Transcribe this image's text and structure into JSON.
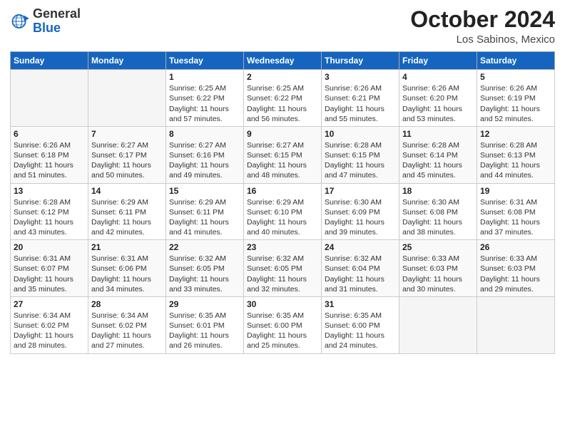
{
  "header": {
    "logo_general": "General",
    "logo_blue": "Blue",
    "month_title": "October 2024",
    "location": "Los Sabinos, Mexico"
  },
  "days_of_week": [
    "Sunday",
    "Monday",
    "Tuesday",
    "Wednesday",
    "Thursday",
    "Friday",
    "Saturday"
  ],
  "weeks": [
    [
      {
        "day": "",
        "sunrise": "",
        "sunset": "",
        "daylight": "",
        "empty": true
      },
      {
        "day": "",
        "sunrise": "",
        "sunset": "",
        "daylight": "",
        "empty": true
      },
      {
        "day": "1",
        "sunrise": "Sunrise: 6:25 AM",
        "sunset": "Sunset: 6:22 PM",
        "daylight": "Daylight: 11 hours and 57 minutes."
      },
      {
        "day": "2",
        "sunrise": "Sunrise: 6:25 AM",
        "sunset": "Sunset: 6:22 PM",
        "daylight": "Daylight: 11 hours and 56 minutes."
      },
      {
        "day": "3",
        "sunrise": "Sunrise: 6:26 AM",
        "sunset": "Sunset: 6:21 PM",
        "daylight": "Daylight: 11 hours and 55 minutes."
      },
      {
        "day": "4",
        "sunrise": "Sunrise: 6:26 AM",
        "sunset": "Sunset: 6:20 PM",
        "daylight": "Daylight: 11 hours and 53 minutes."
      },
      {
        "day": "5",
        "sunrise": "Sunrise: 6:26 AM",
        "sunset": "Sunset: 6:19 PM",
        "daylight": "Daylight: 11 hours and 52 minutes."
      }
    ],
    [
      {
        "day": "6",
        "sunrise": "Sunrise: 6:26 AM",
        "sunset": "Sunset: 6:18 PM",
        "daylight": "Daylight: 11 hours and 51 minutes."
      },
      {
        "day": "7",
        "sunrise": "Sunrise: 6:27 AM",
        "sunset": "Sunset: 6:17 PM",
        "daylight": "Daylight: 11 hours and 50 minutes."
      },
      {
        "day": "8",
        "sunrise": "Sunrise: 6:27 AM",
        "sunset": "Sunset: 6:16 PM",
        "daylight": "Daylight: 11 hours and 49 minutes."
      },
      {
        "day": "9",
        "sunrise": "Sunrise: 6:27 AM",
        "sunset": "Sunset: 6:15 PM",
        "daylight": "Daylight: 11 hours and 48 minutes."
      },
      {
        "day": "10",
        "sunrise": "Sunrise: 6:28 AM",
        "sunset": "Sunset: 6:15 PM",
        "daylight": "Daylight: 11 hours and 47 minutes."
      },
      {
        "day": "11",
        "sunrise": "Sunrise: 6:28 AM",
        "sunset": "Sunset: 6:14 PM",
        "daylight": "Daylight: 11 hours and 45 minutes."
      },
      {
        "day": "12",
        "sunrise": "Sunrise: 6:28 AM",
        "sunset": "Sunset: 6:13 PM",
        "daylight": "Daylight: 11 hours and 44 minutes."
      }
    ],
    [
      {
        "day": "13",
        "sunrise": "Sunrise: 6:28 AM",
        "sunset": "Sunset: 6:12 PM",
        "daylight": "Daylight: 11 hours and 43 minutes."
      },
      {
        "day": "14",
        "sunrise": "Sunrise: 6:29 AM",
        "sunset": "Sunset: 6:11 PM",
        "daylight": "Daylight: 11 hours and 42 minutes."
      },
      {
        "day": "15",
        "sunrise": "Sunrise: 6:29 AM",
        "sunset": "Sunset: 6:11 PM",
        "daylight": "Daylight: 11 hours and 41 minutes."
      },
      {
        "day": "16",
        "sunrise": "Sunrise: 6:29 AM",
        "sunset": "Sunset: 6:10 PM",
        "daylight": "Daylight: 11 hours and 40 minutes."
      },
      {
        "day": "17",
        "sunrise": "Sunrise: 6:30 AM",
        "sunset": "Sunset: 6:09 PM",
        "daylight": "Daylight: 11 hours and 39 minutes."
      },
      {
        "day": "18",
        "sunrise": "Sunrise: 6:30 AM",
        "sunset": "Sunset: 6:08 PM",
        "daylight": "Daylight: 11 hours and 38 minutes."
      },
      {
        "day": "19",
        "sunrise": "Sunrise: 6:31 AM",
        "sunset": "Sunset: 6:08 PM",
        "daylight": "Daylight: 11 hours and 37 minutes."
      }
    ],
    [
      {
        "day": "20",
        "sunrise": "Sunrise: 6:31 AM",
        "sunset": "Sunset: 6:07 PM",
        "daylight": "Daylight: 11 hours and 35 minutes."
      },
      {
        "day": "21",
        "sunrise": "Sunrise: 6:31 AM",
        "sunset": "Sunset: 6:06 PM",
        "daylight": "Daylight: 11 hours and 34 minutes."
      },
      {
        "day": "22",
        "sunrise": "Sunrise: 6:32 AM",
        "sunset": "Sunset: 6:05 PM",
        "daylight": "Daylight: 11 hours and 33 minutes."
      },
      {
        "day": "23",
        "sunrise": "Sunrise: 6:32 AM",
        "sunset": "Sunset: 6:05 PM",
        "daylight": "Daylight: 11 hours and 32 minutes."
      },
      {
        "day": "24",
        "sunrise": "Sunrise: 6:32 AM",
        "sunset": "Sunset: 6:04 PM",
        "daylight": "Daylight: 11 hours and 31 minutes."
      },
      {
        "day": "25",
        "sunrise": "Sunrise: 6:33 AM",
        "sunset": "Sunset: 6:03 PM",
        "daylight": "Daylight: 11 hours and 30 minutes."
      },
      {
        "day": "26",
        "sunrise": "Sunrise: 6:33 AM",
        "sunset": "Sunset: 6:03 PM",
        "daylight": "Daylight: 11 hours and 29 minutes."
      }
    ],
    [
      {
        "day": "27",
        "sunrise": "Sunrise: 6:34 AM",
        "sunset": "Sunset: 6:02 PM",
        "daylight": "Daylight: 11 hours and 28 minutes."
      },
      {
        "day": "28",
        "sunrise": "Sunrise: 6:34 AM",
        "sunset": "Sunset: 6:02 PM",
        "daylight": "Daylight: 11 hours and 27 minutes."
      },
      {
        "day": "29",
        "sunrise": "Sunrise: 6:35 AM",
        "sunset": "Sunset: 6:01 PM",
        "daylight": "Daylight: 11 hours and 26 minutes."
      },
      {
        "day": "30",
        "sunrise": "Sunrise: 6:35 AM",
        "sunset": "Sunset: 6:00 PM",
        "daylight": "Daylight: 11 hours and 25 minutes."
      },
      {
        "day": "31",
        "sunrise": "Sunrise: 6:35 AM",
        "sunset": "Sunset: 6:00 PM",
        "daylight": "Daylight: 11 hours and 24 minutes."
      },
      {
        "day": "",
        "sunrise": "",
        "sunset": "",
        "daylight": "",
        "empty": true
      },
      {
        "day": "",
        "sunrise": "",
        "sunset": "",
        "daylight": "",
        "empty": true
      }
    ]
  ]
}
